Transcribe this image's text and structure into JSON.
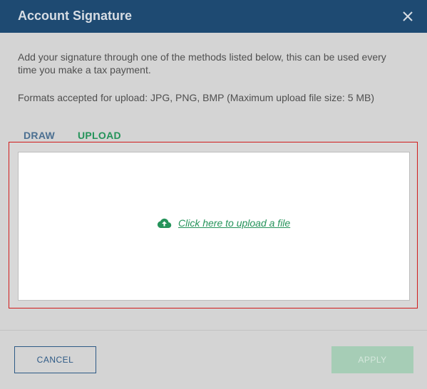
{
  "dialog": {
    "title": "Account Signature",
    "close_icon": "close-icon"
  },
  "description": "Add your signature through one of the methods listed below, this can be used every time you make a tax payment.",
  "formats_note": "Formats accepted for upload: JPG, PNG, BMP (Maximum upload file size: 5 MB)",
  "tabs": [
    {
      "label": "DRAW",
      "active": false
    },
    {
      "label": "UPLOAD",
      "active": true
    }
  ],
  "upload": {
    "icon": "cloud-upload-icon",
    "link_text": "Click here to upload a file"
  },
  "buttons": {
    "cancel": "CANCEL",
    "apply": "APPLY"
  },
  "colors": {
    "header_bg": "#1e4a72",
    "accent_green": "#25935a",
    "tab_inactive": "#4b6f91",
    "highlight_border": "#d11b1b",
    "apply_disabled_bg": "#a6cdb6"
  }
}
